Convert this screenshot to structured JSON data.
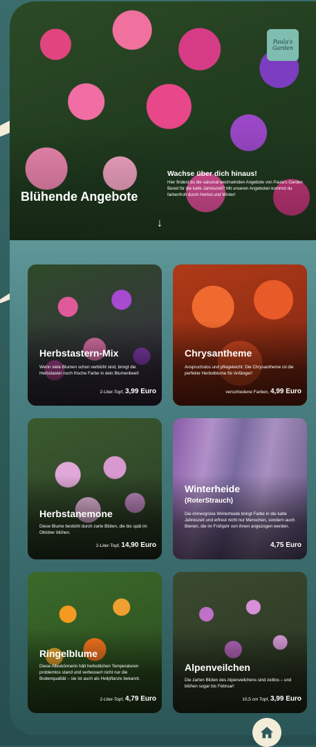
{
  "hero": {
    "title": "Blühende Angebote",
    "headline": "Wachse über dich hinaus!",
    "text": "Hier findest du die saisonal wechselnden Angebote von Paula's Garden Bereit für die kalte Jahreszeit? Mit unseren Angeboten kommst du farbenfroh durch Herbst und Winter!",
    "logo_line1": "Paula's",
    "logo_line2": "Garden",
    "scroll_icon": "arrow-down-icon"
  },
  "cards": [
    {
      "title": "Herbstastern-Mix",
      "subtitle": "",
      "desc": "Wenn viele Blumen schon verblüht sind, bringt die Herbstaster noch frische Farbe in dein Blumenbeet!",
      "price_prefix": "2-Liter-Topf,",
      "price": "3,99 Euro"
    },
    {
      "title": "Chrysantheme",
      "subtitle": "",
      "desc": "Anspruchslos und pflegeleicht: Die Chrysantheme ist die perfekte Herbstblume für Anfänger!",
      "price_prefix": "verschiedene Farben,",
      "price": "4,99 Euro"
    },
    {
      "title": "Herbstanemone",
      "subtitle": "",
      "desc": "Diese Blume besticht durch zarte Blüten, die bis spät im Oktober blühen.",
      "price_prefix": "2-Liter-Topf,",
      "price": "14,90 Euro"
    },
    {
      "title": "Winterheide",
      "subtitle": "(RoterStrauch)",
      "desc": "Die immergrüne Winterheide bringt Farbe in die kalte Jahreszeit und erfreut nicht nur Menschen, sondern auch Bienen, die im Frühjahr von ihnen angezogen werden.",
      "price_prefix": "",
      "price": "4,75 Euro"
    },
    {
      "title": "Ringelblume",
      "subtitle": "",
      "desc": "Diese Alleskönnerin hält herbstlichen Temperaturen problemlos stand und verbessert nicht nur die Bodenqualität – sie ist auch als Heilpflanze bekannt.",
      "price_prefix": "2-Liter-Topf,",
      "price": "4,79 Euro"
    },
    {
      "title": "Alpenveilchen",
      "subtitle": "",
      "desc": "Die zarten Blüten des Alpenveilchens sind zeitlos – und blühen sogar bis Februar!",
      "price_prefix": "10,5 cm Topf,",
      "price": "3,99 Euro"
    }
  ],
  "nav": {
    "home_icon": "home-icon"
  },
  "colors": {
    "background": "#2f5a5c",
    "accent": "#f3ecd9",
    "logo_bg": "#7fbdb1"
  }
}
